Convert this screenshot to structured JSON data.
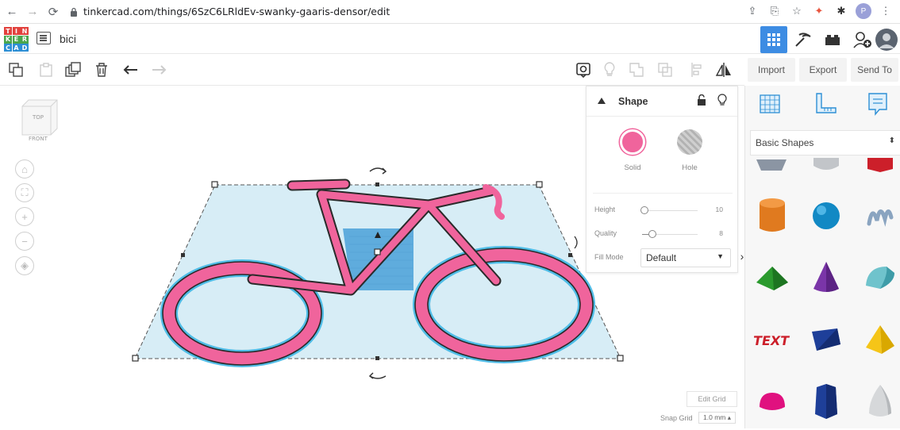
{
  "browser": {
    "url": "tinkercad.com/things/6SzC6LRldEv-swanky-gaaris-densor/edit",
    "profile_initial": "P"
  },
  "header": {
    "logo_letters": [
      "T",
      "I",
      "N",
      "K",
      "E",
      "R",
      "C",
      "A",
      "D"
    ],
    "design_name": "bici"
  },
  "import_export": {
    "import_label": "Import",
    "export_label": "Export",
    "send_to_label": "Send To"
  },
  "viewcube": {
    "top_label": "TOP",
    "front_label": "FRONT"
  },
  "inspector": {
    "title": "Shape",
    "solid_label": "Solid",
    "hole_label": "Hole",
    "solid_color": "#f0649c",
    "height_label": "Height",
    "height_value": "10",
    "quality_label": "Quality",
    "quality_value": "8",
    "fill_mode_label": "Fill Mode",
    "fill_mode_value": "Default"
  },
  "shapes": {
    "category": "Basic Shapes",
    "items": [
      "box",
      "cylinder",
      "sphere",
      "scribble",
      "roof",
      "cone",
      "round-roof",
      "text",
      "wedge",
      "pyramid",
      "half-sphere",
      "polygon",
      "paraboloid"
    ]
  },
  "grid": {
    "edit_grid_label": "Edit Grid",
    "snap_grid_label": "Snap Grid",
    "snap_grid_value": "1.0 mm ▴"
  },
  "colors": {
    "accent": "#3d8ce3",
    "bike_pink": "#f0649c",
    "workplane_tint": "#d7edf6"
  }
}
